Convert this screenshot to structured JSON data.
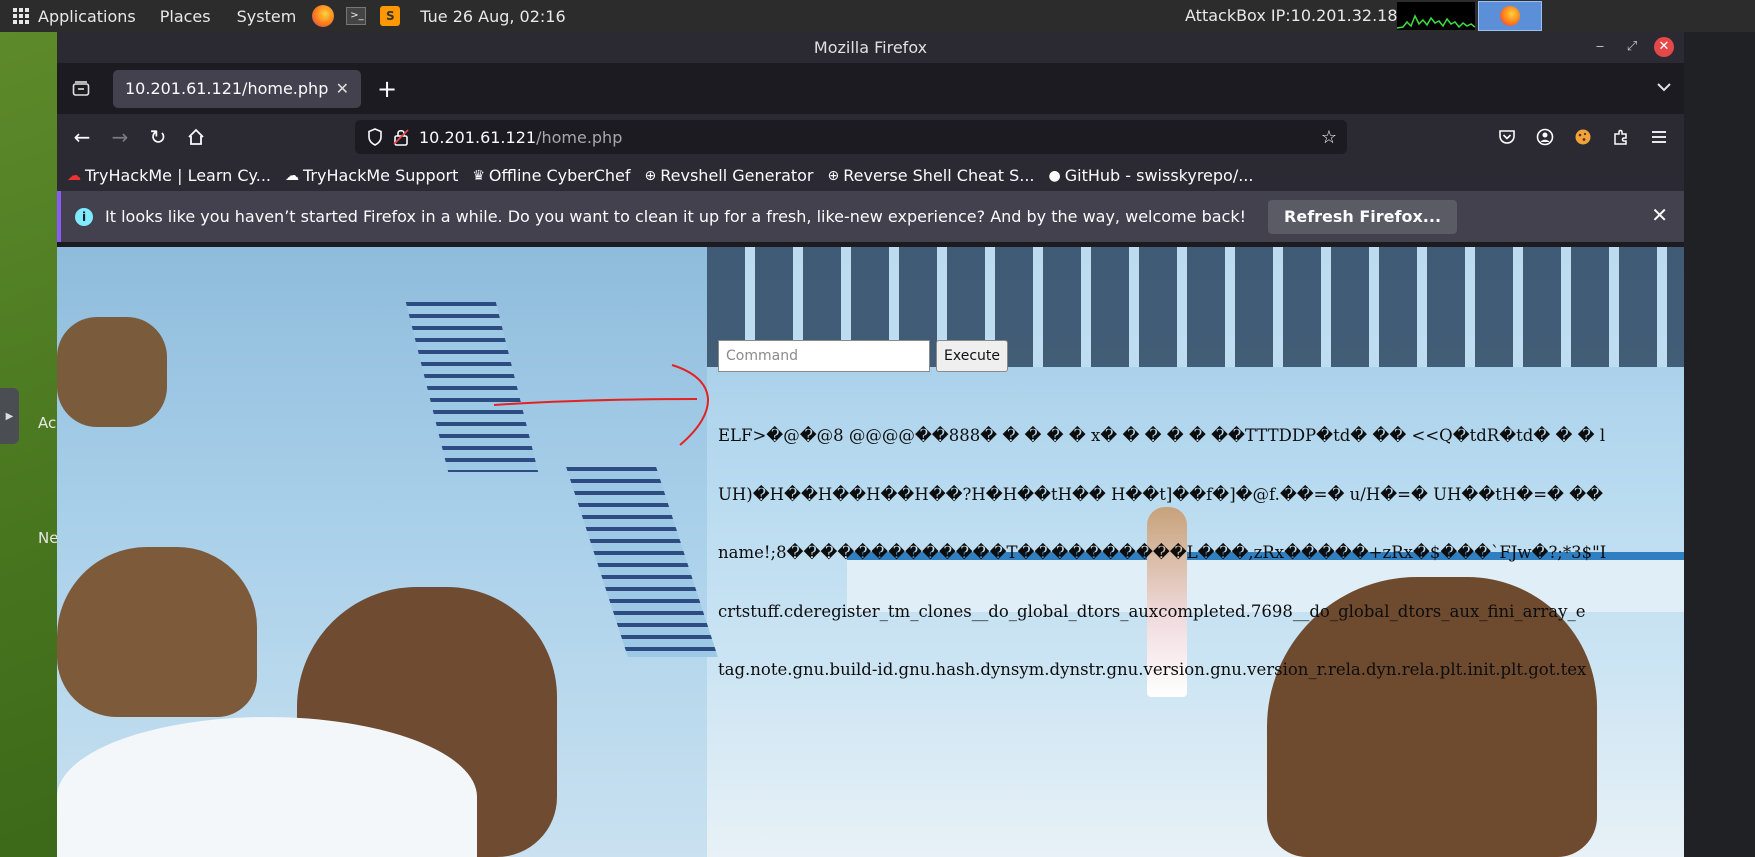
{
  "top_panel": {
    "applications": "Applications",
    "places": "Places",
    "system": "System",
    "datetime": "Tue 26 Aug, 02:16",
    "ip_label": "AttackBox IP:10.201.32.183"
  },
  "desktop": {
    "label_1": "Ac",
    "label_2": "Ne"
  },
  "window": {
    "title": "Mozilla Firefox"
  },
  "tab": {
    "title": "10.201.61.121/home.php"
  },
  "url": {
    "host": "10.201.61.121",
    "path": "/home.php"
  },
  "bookmarks": [
    {
      "label": "TryHackMe | Learn Cy...",
      "icon": "thm-icon"
    },
    {
      "label": "TryHackMe Support",
      "icon": "support-icon"
    },
    {
      "label": "Offline CyberChef",
      "icon": "chef-icon"
    },
    {
      "label": "Revshell Generator",
      "icon": "globe-icon"
    },
    {
      "label": "Reverse Shell Cheat S...",
      "icon": "globe-icon"
    },
    {
      "label": "GitHub - swisskyrepo/...",
      "icon": "github-icon"
    }
  ],
  "notification": {
    "message": "It looks like you haven’t started Firefox in a while. Do you want to clean it up for a fresh, like-new experience? And by the way, welcome back!",
    "button": "Refresh Firefox..."
  },
  "page": {
    "command_placeholder": "Command",
    "execute_label": "Execute",
    "output_lines": [
      "ELF>�@�@8 @@@@��888� � � � � x� � � � � ��TTTDDP�td� �� <<Q�tdR�td� � � l",
      "UH)�H��H��H��H��?H�H��tH�� H��t]��f�]�@f.��=� u/H�=� UH��tH�=� ��",
      "name!;8�������������T����������L���,zRx�����+zRx�$���`FJw�?;*3$\"I",
      "crtstuff.cderegister_tm_clones__do_global_dtors_auxcompleted.7698__do_global_dtors_aux_fini_array_e",
      "tag.note.gnu.build-id.gnu.hash.dynsym.dynstr.gnu.version.gnu.version_r.rela.dyn.rela.plt.init.plt.got.tex"
    ]
  },
  "colors": {
    "accent": "#8a5cf5",
    "close_button": "#e54848",
    "annotation_arrow": "#e32222"
  }
}
